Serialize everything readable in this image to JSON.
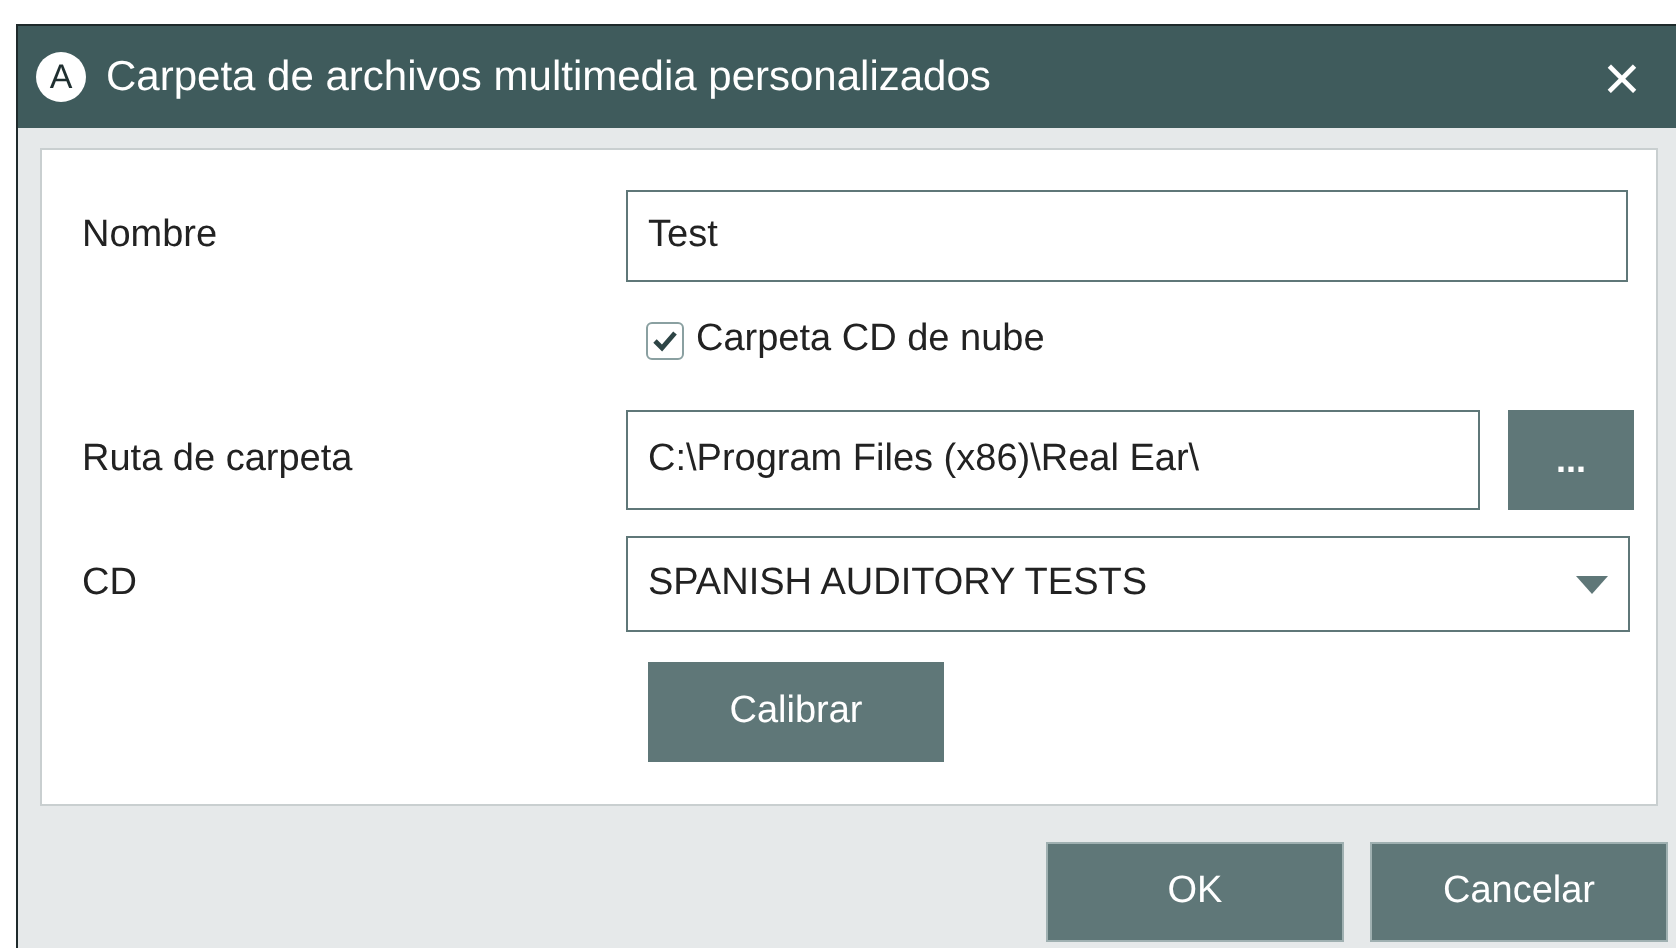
{
  "window": {
    "title": "Carpeta de archivos multimedia personalizados",
    "app_letter": "A",
    "close": "×"
  },
  "form": {
    "name": {
      "label": "Nombre",
      "value": "Test"
    },
    "cloud": {
      "label": "Carpeta CD de nube",
      "checked": true
    },
    "path": {
      "label": "Ruta de carpeta",
      "value": "C:\\Program Files (x86)\\Real Ear\\",
      "browse": "..."
    },
    "cd": {
      "label": "CD",
      "value": "SPANISH AUDITORY TESTS"
    },
    "calibrate": "Calibrar"
  },
  "buttons": [
    "OK",
    "Cancelar"
  ]
}
